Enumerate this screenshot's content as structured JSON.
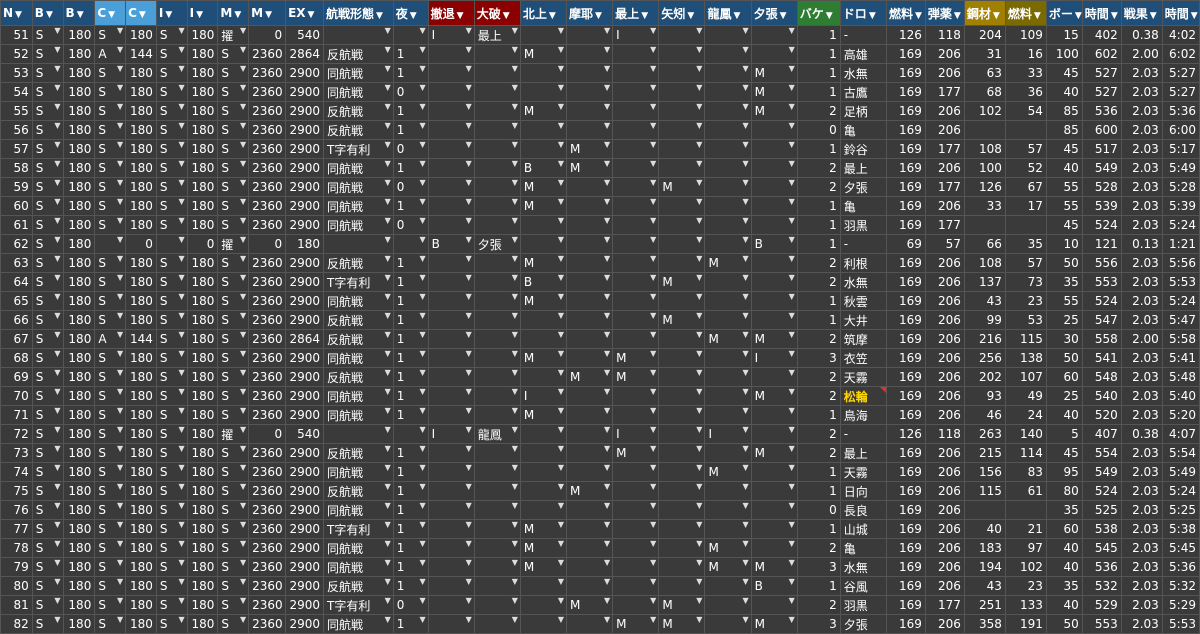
{
  "colors": {
    "header_blue": "#1f4e79",
    "header_light_blue": "#4a9fd8",
    "header_darkred": "#8b0000",
    "header_green": "#2e7d32",
    "header_gold": "#a08000",
    "header_olive": "#7a6a00",
    "cell_bg": "#3a3a3a",
    "highlight_text": "#ffd700"
  },
  "columns": [
    {
      "label": "N",
      "style": "blue"
    },
    {
      "label": "B",
      "style": "blue"
    },
    {
      "label": "B",
      "style": "blue"
    },
    {
      "label": "C",
      "style": "lightblue"
    },
    {
      "label": "C",
      "style": "lightblue"
    },
    {
      "label": "I",
      "style": "blue"
    },
    {
      "label": "I",
      "style": "blue"
    },
    {
      "label": "M",
      "style": "blue"
    },
    {
      "label": "M",
      "style": "blue"
    },
    {
      "label": "EX",
      "style": "blue"
    },
    {
      "label": "航戦形態",
      "style": "blue"
    },
    {
      "label": "夜",
      "style": "blue"
    },
    {
      "label": "撤退",
      "style": "darkred"
    },
    {
      "label": "大破",
      "style": "darkred"
    },
    {
      "label": "北上",
      "style": "blue"
    },
    {
      "label": "摩耶",
      "style": "blue"
    },
    {
      "label": "最上",
      "style": "blue"
    },
    {
      "label": "矢矧",
      "style": "blue"
    },
    {
      "label": "龍鳳",
      "style": "blue"
    },
    {
      "label": "夕張",
      "style": "blue"
    },
    {
      "label": "バケ",
      "style": "green"
    },
    {
      "label": "ドロ",
      "style": "blue"
    },
    {
      "label": "燃料",
      "style": "blue"
    },
    {
      "label": "弾薬",
      "style": "blue"
    },
    {
      "label": "鋼材",
      "style": "gold"
    },
    {
      "label": "燃料",
      "style": "olive"
    },
    {
      "label": "ボー",
      "style": "blue"
    },
    {
      "label": "時間",
      "style": "blue"
    },
    {
      "label": "戦果",
      "style": "blue"
    },
    {
      "label": "時間",
      "style": "blue"
    }
  ],
  "rows": [
    [
      "51",
      "S",
      "180",
      "S",
      "180",
      "S",
      "180",
      "擢",
      "0",
      "540",
      "",
      "",
      "I",
      "最上",
      "",
      "",
      "I",
      "",
      "",
      "",
      "1",
      "-",
      "126",
      "118",
      "204",
      "109",
      "15",
      "402",
      "0.38",
      "4:02"
    ],
    [
      "52",
      "S",
      "180",
      "A",
      "144",
      "S",
      "180",
      "S",
      "2360",
      "2864",
      "反航戦",
      "1",
      "",
      "",
      "M",
      "",
      "",
      "",
      "",
      "",
      "1",
      "高雄",
      "169",
      "206",
      "31",
      "16",
      "100",
      "602",
      "2.00",
      "6:02"
    ],
    [
      "53",
      "S",
      "180",
      "S",
      "180",
      "S",
      "180",
      "S",
      "2360",
      "2900",
      "同航戦",
      "1",
      "",
      "",
      "",
      "",
      "",
      "",
      "",
      "M",
      "1",
      "水無",
      "169",
      "206",
      "63",
      "33",
      "45",
      "527",
      "2.03",
      "5:27"
    ],
    [
      "54",
      "S",
      "180",
      "S",
      "180",
      "S",
      "180",
      "S",
      "2360",
      "2900",
      "同航戦",
      "0",
      "",
      "",
      "",
      "",
      "",
      "",
      "",
      "M",
      "1",
      "古鷹",
      "169",
      "177",
      "68",
      "36",
      "40",
      "527",
      "2.03",
      "5:27"
    ],
    [
      "55",
      "S",
      "180",
      "S",
      "180",
      "S",
      "180",
      "S",
      "2360",
      "2900",
      "反航戦",
      "1",
      "",
      "",
      "M",
      "",
      "",
      "",
      "",
      "M",
      "2",
      "足柄",
      "169",
      "206",
      "102",
      "54",
      "85",
      "536",
      "2.03",
      "5:36"
    ],
    [
      "56",
      "S",
      "180",
      "S",
      "180",
      "S",
      "180",
      "S",
      "2360",
      "2900",
      "反航戦",
      "1",
      "",
      "",
      "",
      "",
      "",
      "",
      "",
      "",
      "0",
      "亀",
      "169",
      "206",
      "",
      "",
      "85",
      "600",
      "2.03",
      "6:00"
    ],
    [
      "57",
      "S",
      "180",
      "S",
      "180",
      "S",
      "180",
      "S",
      "2360",
      "2900",
      "T字有利",
      "0",
      "",
      "",
      "",
      "M",
      "",
      "",
      "",
      "",
      "1",
      "鈴谷",
      "169",
      "177",
      "108",
      "57",
      "45",
      "517",
      "2.03",
      "5:17"
    ],
    [
      "58",
      "S",
      "180",
      "S",
      "180",
      "S",
      "180",
      "S",
      "2360",
      "2900",
      "同航戦",
      "1",
      "",
      "",
      "B",
      "M",
      "",
      "",
      "",
      "",
      "2",
      "最上",
      "169",
      "206",
      "100",
      "52",
      "40",
      "549",
      "2.03",
      "5:49"
    ],
    [
      "59",
      "S",
      "180",
      "S",
      "180",
      "S",
      "180",
      "S",
      "2360",
      "2900",
      "同航戦",
      "0",
      "",
      "",
      "M",
      "",
      "",
      "M",
      "",
      "",
      "2",
      "夕張",
      "169",
      "177",
      "126",
      "67",
      "55",
      "528",
      "2.03",
      "5:28"
    ],
    [
      "60",
      "S",
      "180",
      "S",
      "180",
      "S",
      "180",
      "S",
      "2360",
      "2900",
      "同航戦",
      "1",
      "",
      "",
      "M",
      "",
      "",
      "",
      "",
      "",
      "1",
      "亀",
      "169",
      "206",
      "33",
      "17",
      "55",
      "539",
      "2.03",
      "5:39"
    ],
    [
      "61",
      "S",
      "180",
      "S",
      "180",
      "S",
      "180",
      "S",
      "2360",
      "2900",
      "同航戦",
      "0",
      "",
      "",
      "",
      "",
      "",
      "",
      "",
      "",
      "1",
      "羽黒",
      "169",
      "177",
      "",
      "",
      "45",
      "524",
      "2.03",
      "5:24"
    ],
    [
      "62",
      "S",
      "180",
      "",
      "0",
      "",
      "0",
      "擢",
      "0",
      "180",
      "",
      "",
      "B",
      "夕張",
      "",
      "",
      "",
      "",
      "",
      "B",
      "1",
      "-",
      "69",
      "57",
      "66",
      "35",
      "10",
      "121",
      "0.13",
      "1:21"
    ],
    [
      "63",
      "S",
      "180",
      "S",
      "180",
      "S",
      "180",
      "S",
      "2360",
      "2900",
      "反航戦",
      "1",
      "",
      "",
      "M",
      "",
      "",
      "",
      "M",
      "",
      "2",
      "利根",
      "169",
      "206",
      "108",
      "57",
      "50",
      "556",
      "2.03",
      "5:56"
    ],
    [
      "64",
      "S",
      "180",
      "S",
      "180",
      "S",
      "180",
      "S",
      "2360",
      "2900",
      "T字有利",
      "1",
      "",
      "",
      "B",
      "",
      "",
      "M",
      "",
      "",
      "2",
      "水無",
      "169",
      "206",
      "137",
      "73",
      "35",
      "553",
      "2.03",
      "5:53"
    ],
    [
      "65",
      "S",
      "180",
      "S",
      "180",
      "S",
      "180",
      "S",
      "2360",
      "2900",
      "同航戦",
      "1",
      "",
      "",
      "M",
      "",
      "",
      "",
      "",
      "",
      "1",
      "秋雲",
      "169",
      "206",
      "43",
      "23",
      "55",
      "524",
      "2.03",
      "5:24"
    ],
    [
      "66",
      "S",
      "180",
      "S",
      "180",
      "S",
      "180",
      "S",
      "2360",
      "2900",
      "反航戦",
      "1",
      "",
      "",
      "",
      "",
      "",
      "M",
      "",
      "",
      "1",
      "大井",
      "169",
      "206",
      "99",
      "53",
      "25",
      "547",
      "2.03",
      "5:47"
    ],
    [
      "67",
      "S",
      "180",
      "A",
      "144",
      "S",
      "180",
      "S",
      "2360",
      "2864",
      "反航戦",
      "1",
      "",
      "",
      "",
      "",
      "",
      "",
      "M",
      "M",
      "2",
      "筑摩",
      "169",
      "206",
      "216",
      "115",
      "30",
      "558",
      "2.00",
      "5:58"
    ],
    [
      "68",
      "S",
      "180",
      "S",
      "180",
      "S",
      "180",
      "S",
      "2360",
      "2900",
      "同航戦",
      "1",
      "",
      "",
      "M",
      "",
      "M",
      "",
      "",
      "I",
      "3",
      "衣笠",
      "169",
      "206",
      "256",
      "138",
      "50",
      "541",
      "2.03",
      "5:41"
    ],
    [
      "69",
      "S",
      "180",
      "S",
      "180",
      "S",
      "180",
      "S",
      "2360",
      "2900",
      "反航戦",
      "1",
      "",
      "",
      "",
      "M",
      "M",
      "",
      "",
      "",
      "2",
      "天霧",
      "169",
      "206",
      "202",
      "107",
      "60",
      "548",
      "2.03",
      "5:48"
    ],
    [
      "70",
      "S",
      "180",
      "S",
      "180",
      "S",
      "180",
      "S",
      "2360",
      "2900",
      "同航戦",
      "1",
      "",
      "",
      "I",
      "",
      "",
      "",
      "",
      "M",
      "2",
      "松輪",
      "169",
      "206",
      "93",
      "49",
      "25",
      "540",
      "2.03",
      "5:40"
    ],
    [
      "71",
      "S",
      "180",
      "S",
      "180",
      "S",
      "180",
      "S",
      "2360",
      "2900",
      "同航戦",
      "1",
      "",
      "",
      "M",
      "",
      "",
      "",
      "",
      "",
      "1",
      "鳥海",
      "169",
      "206",
      "46",
      "24",
      "40",
      "520",
      "2.03",
      "5:20"
    ],
    [
      "72",
      "S",
      "180",
      "S",
      "180",
      "S",
      "180",
      "擢",
      "0",
      "540",
      "",
      "",
      "I",
      "龍鳳",
      "",
      "",
      "I",
      "",
      "I",
      "",
      "2",
      "-",
      "126",
      "118",
      "263",
      "140",
      "5",
      "407",
      "0.38",
      "4:07"
    ],
    [
      "73",
      "S",
      "180",
      "S",
      "180",
      "S",
      "180",
      "S",
      "2360",
      "2900",
      "反航戦",
      "1",
      "",
      "",
      "",
      "",
      "M",
      "",
      "",
      "M",
      "2",
      "最上",
      "169",
      "206",
      "215",
      "114",
      "45",
      "554",
      "2.03",
      "5:54"
    ],
    [
      "74",
      "S",
      "180",
      "S",
      "180",
      "S",
      "180",
      "S",
      "2360",
      "2900",
      "同航戦",
      "1",
      "",
      "",
      "",
      "",
      "",
      "",
      "M",
      "",
      "1",
      "天霧",
      "169",
      "206",
      "156",
      "83",
      "95",
      "549",
      "2.03",
      "5:49"
    ],
    [
      "75",
      "S",
      "180",
      "S",
      "180",
      "S",
      "180",
      "S",
      "2360",
      "2900",
      "反航戦",
      "1",
      "",
      "",
      "",
      "M",
      "",
      "",
      "",
      "",
      "1",
      "日向",
      "169",
      "206",
      "115",
      "61",
      "80",
      "524",
      "2.03",
      "5:24"
    ],
    [
      "76",
      "S",
      "180",
      "S",
      "180",
      "S",
      "180",
      "S",
      "2360",
      "2900",
      "同航戦",
      "1",
      "",
      "",
      "",
      "",
      "",
      "",
      "",
      "",
      "0",
      "長良",
      "169",
      "206",
      "",
      "",
      "35",
      "525",
      "2.03",
      "5:25"
    ],
    [
      "77",
      "S",
      "180",
      "S",
      "180",
      "S",
      "180",
      "S",
      "2360",
      "2900",
      "T字有利",
      "1",
      "",
      "",
      "M",
      "",
      "",
      "",
      "",
      "",
      "1",
      "山城",
      "169",
      "206",
      "40",
      "21",
      "60",
      "538",
      "2.03",
      "5:38"
    ],
    [
      "78",
      "S",
      "180",
      "S",
      "180",
      "S",
      "180",
      "S",
      "2360",
      "2900",
      "同航戦",
      "1",
      "",
      "",
      "M",
      "",
      "",
      "",
      "M",
      "",
      "2",
      "亀",
      "169",
      "206",
      "183",
      "97",
      "40",
      "545",
      "2.03",
      "5:45"
    ],
    [
      "79",
      "S",
      "180",
      "S",
      "180",
      "S",
      "180",
      "S",
      "2360",
      "2900",
      "同航戦",
      "1",
      "",
      "",
      "M",
      "",
      "",
      "",
      "M",
      "M",
      "3",
      "水無",
      "169",
      "206",
      "194",
      "102",
      "40",
      "536",
      "2.03",
      "5:36"
    ],
    [
      "80",
      "S",
      "180",
      "S",
      "180",
      "S",
      "180",
      "S",
      "2360",
      "2900",
      "反航戦",
      "1",
      "",
      "",
      "",
      "",
      "",
      "",
      "",
      "B",
      "1",
      "谷風",
      "169",
      "206",
      "43",
      "23",
      "35",
      "532",
      "2.03",
      "5:32"
    ],
    [
      "81",
      "S",
      "180",
      "S",
      "180",
      "S",
      "180",
      "S",
      "2360",
      "2900",
      "T字有利",
      "0",
      "",
      "",
      "",
      "M",
      "",
      "M",
      "",
      "",
      "2",
      "羽黒",
      "169",
      "177",
      "251",
      "133",
      "40",
      "529",
      "2.03",
      "5:29"
    ],
    [
      "82",
      "S",
      "180",
      "S",
      "180",
      "S",
      "180",
      "S",
      "2360",
      "2900",
      "同航戦",
      "1",
      "",
      "",
      "",
      "",
      "M",
      "M",
      "",
      "M",
      "3",
      "夕張",
      "169",
      "206",
      "358",
      "191",
      "50",
      "553",
      "2.03",
      "5:53"
    ]
  ],
  "highlight": {
    "row": "70",
    "col": 21,
    "text": "松輪"
  }
}
